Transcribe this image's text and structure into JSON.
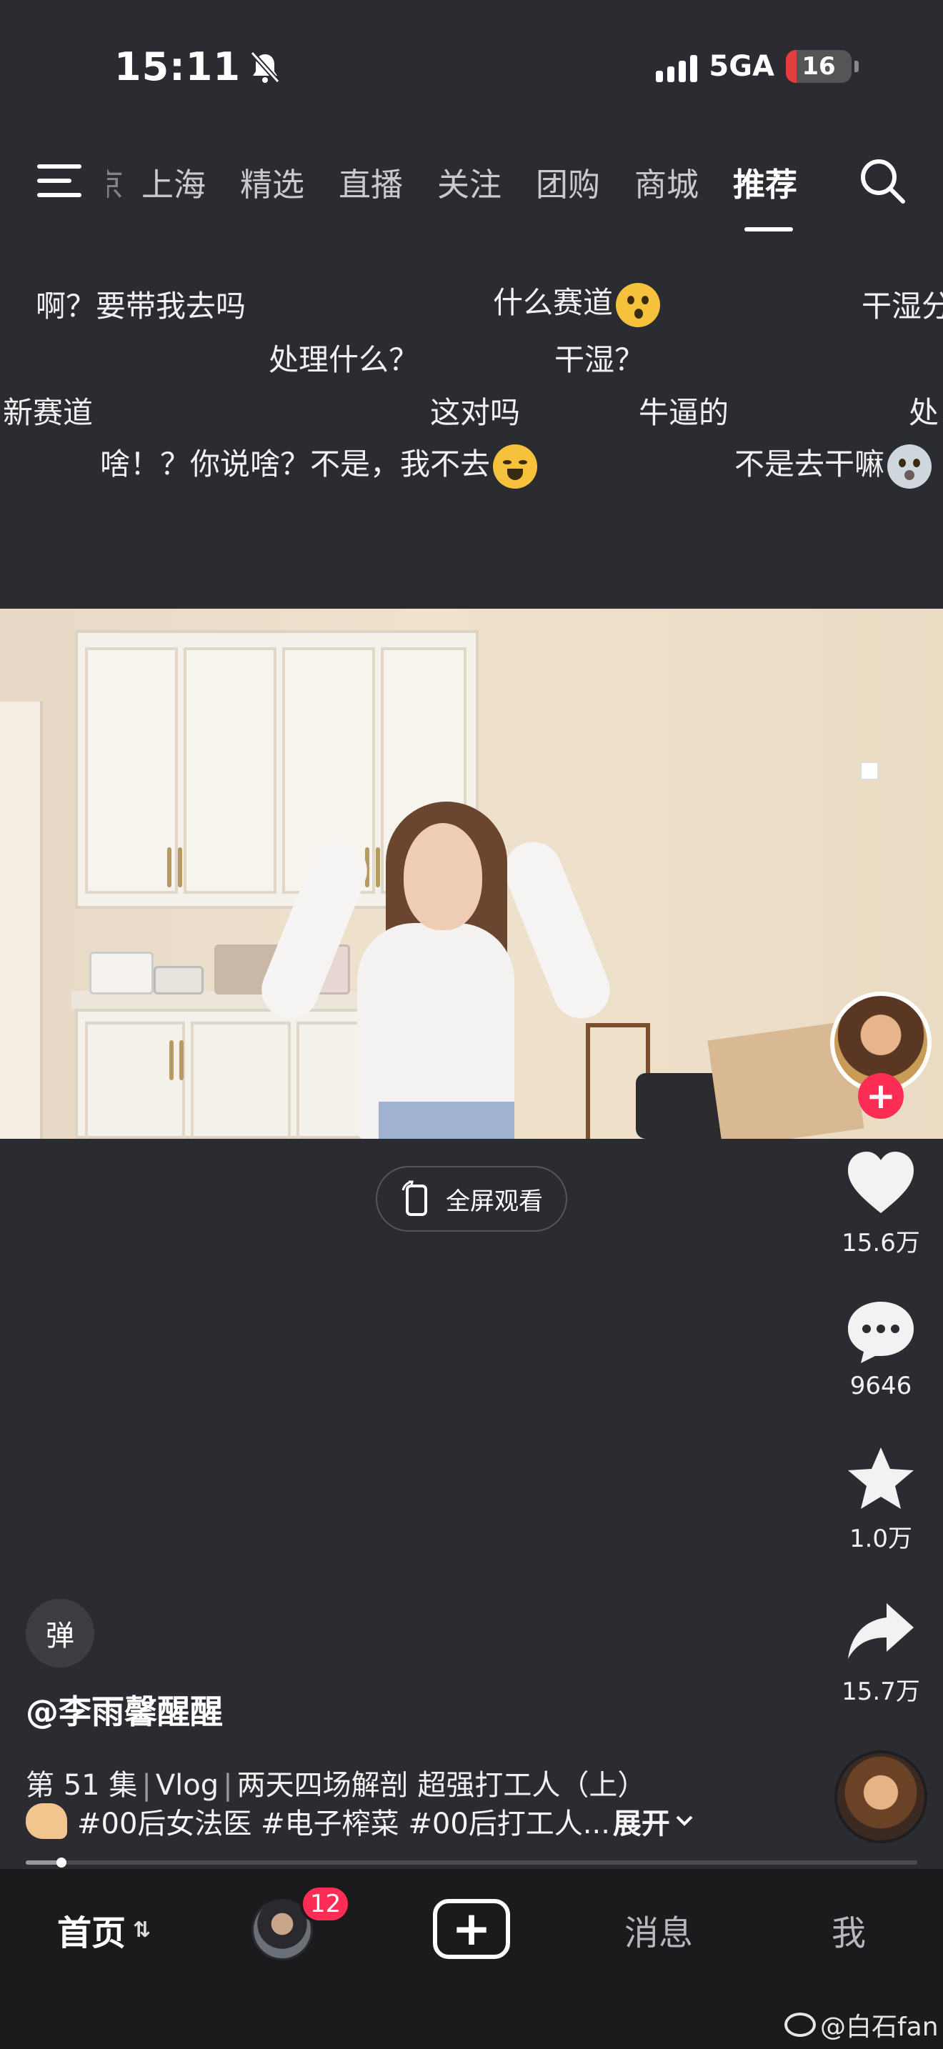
{
  "status": {
    "time": "15:11",
    "network": "5GA",
    "battery": "16",
    "battery_fraction": 0.16
  },
  "topnav": {
    "tabs": [
      "京",
      "上海",
      "精选",
      "直播",
      "关注",
      "团购",
      "商城",
      "推荐"
    ],
    "active": "推荐"
  },
  "danmaku": [
    "啊？要带我去吗",
    "什么赛道",
    "干湿分",
    "处理什么？",
    "干湿？",
    "新赛道",
    "这对吗",
    "牛逼的",
    "处",
    "啥！？你说啥？不是，我不去",
    "不是去干嘛"
  ],
  "fullscreen_label": "全屏观看",
  "rail": {
    "likes": "15.6万",
    "comments": "9646",
    "favorites": "1.0万",
    "shares": "15.7万"
  },
  "caption": {
    "danmu_toggle": "弹",
    "author": "@李雨馨醒醒",
    "episode": "第 51 集",
    "series": "Vlog",
    "title": "两天四场解剖 超强打工人（上）",
    "tags": "#00后女法医 #电子榨菜 #00后打工人...",
    "more": "展开",
    "progress": 0.04
  },
  "bottomnav": {
    "home": "首页",
    "badge": "12",
    "messages": "消息",
    "me": "我"
  },
  "watermark": "@白石fan"
}
